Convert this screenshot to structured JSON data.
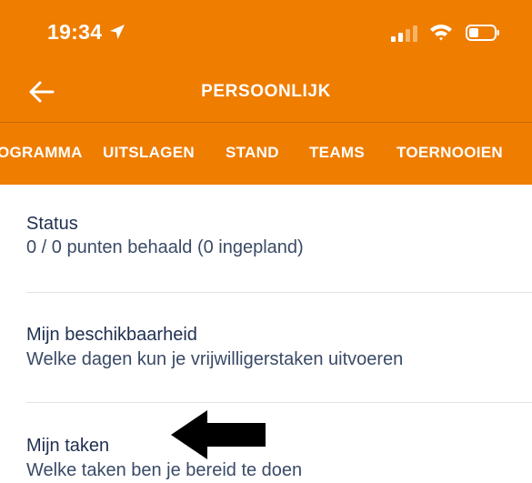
{
  "status_bar": {
    "time": "19:34",
    "icons": [
      "location-arrow-icon",
      "signal-icon",
      "wifi-icon",
      "battery-icon"
    ]
  },
  "nav": {
    "title": "PERSOONLIJK",
    "back_icon": "back-arrow-icon"
  },
  "tabs": [
    "OGRAMMA",
    "UITSLAGEN",
    "STAND",
    "TEAMS",
    "TOERNOOIEN"
  ],
  "list": [
    {
      "title": "Status",
      "subtitle": "0 / 0 punten behaald (0 ingepland)"
    },
    {
      "title": "Mijn beschikbaarheid",
      "subtitle": "Welke dagen kun je vrijwilligerstaken uitvoeren"
    },
    {
      "title": "Mijn taken",
      "subtitle": "Welke taken ben je bereid te doen"
    }
  ],
  "annotation": {
    "icon": "left-arrow-annotation-icon",
    "color": "#000000"
  },
  "colors": {
    "header": "#ef7d00",
    "title_text": "#1f2f4f",
    "subtitle_text": "#3a4a66"
  }
}
